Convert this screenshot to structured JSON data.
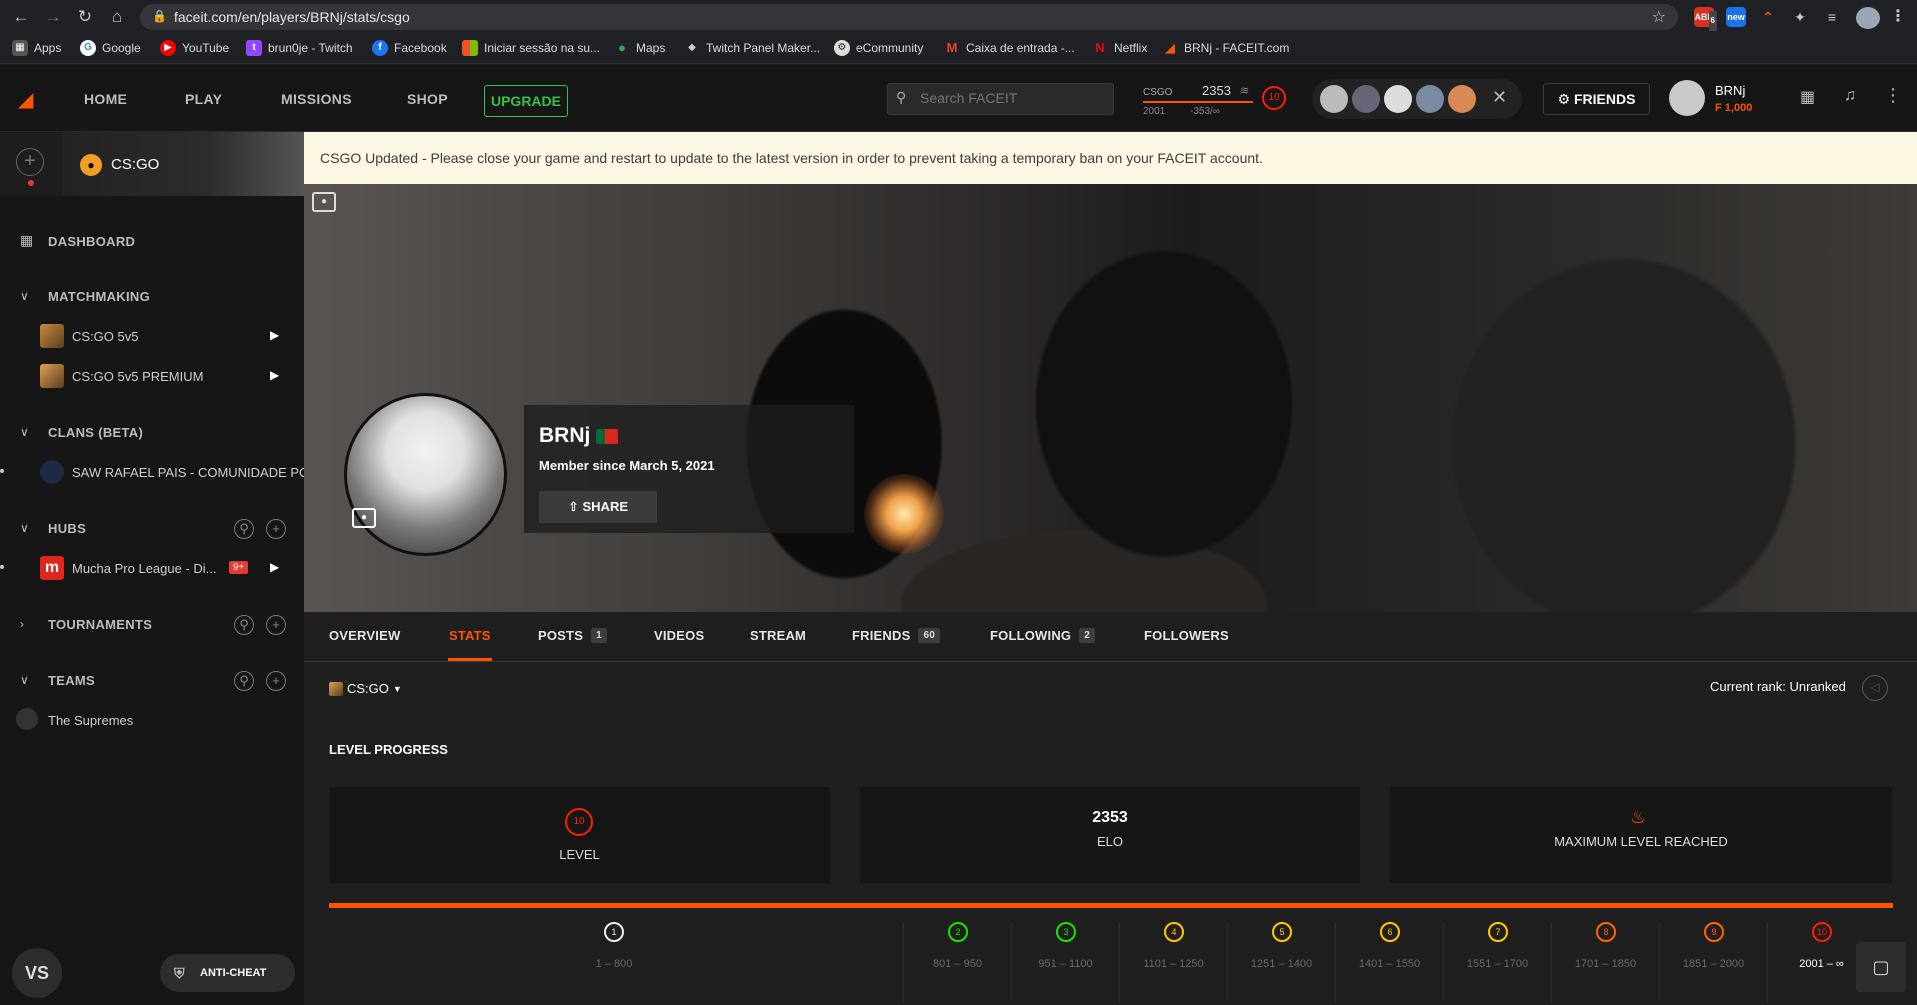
{
  "browser": {
    "url": "faceit.com/en/players/BRNj/stats/csgo",
    "bookmarks": [
      "Apps",
      "Google",
      "YouTube",
      "brun0je - Twitch",
      "Facebook",
      "Iniciar sessão na su...",
      "Maps",
      "Twitch Panel Maker...",
      "eCommunity",
      "Caixa de entrada -...",
      "Netflix",
      "BRNj - FACEIT.com"
    ],
    "ext_badges": [
      "6",
      "new"
    ]
  },
  "topbar": {
    "nav": [
      "HOME",
      "PLAY",
      "MISSIONS",
      "SHOP"
    ],
    "upgrade": "UPGRADE",
    "search_placeholder": "Search FACEIT",
    "game": "CSGO",
    "elo": "2353",
    "elo_min": "2001",
    "elo_diff": "-353/∞",
    "level": "10",
    "friends": "FRIENDS",
    "username": "BRNj",
    "points": "1,000"
  },
  "sidebar": {
    "game": "CS:GO",
    "dashboard": "DASHBOARD",
    "matchmaking": "MATCHMAKING",
    "mm_items": [
      "CS:GO 5v5",
      "CS:GO 5v5 PREMIUM"
    ],
    "clans": "CLANS (BETA)",
    "clan_item": "SAW RAFAEL PAIS - COMUNIDADE PORTUGUESA",
    "hubs": "HUBS",
    "hub_item": "Mucha Pro League - Di...",
    "hub_badge": "9+",
    "tournaments": "TOURNAMENTS",
    "teams": "TEAMS",
    "team_item": "The Supremes",
    "vs": "VS",
    "anticheat": "ANTI-CHEAT"
  },
  "notice": "CSGO Updated - Please close your game and restart to update to the latest version in order to prevent taking a temporary ban on your FACEIT account.",
  "profile": {
    "name": "BRNj",
    "member_since": "Member since March 5, 2021",
    "share": "SHARE"
  },
  "tabs": [
    {
      "label": "OVERVIEW",
      "count": ""
    },
    {
      "label": "STATS",
      "count": ""
    },
    {
      "label": "POSTS",
      "count": "1"
    },
    {
      "label": "VIDEOS",
      "count": ""
    },
    {
      "label": "STREAM",
      "count": ""
    },
    {
      "label": "FRIENDS",
      "count": "60"
    },
    {
      "label": "FOLLOWING",
      "count": "2"
    },
    {
      "label": "FOLLOWERS",
      "count": ""
    }
  ],
  "stats": {
    "game_select": "CS:GO",
    "current_rank": "Current rank: Unranked",
    "section_title": "LEVEL PROGRESS",
    "level_value": "10",
    "level_label": "LEVEL",
    "elo_value": "2353",
    "elo_label": "ELO",
    "max_label": "MAXIMUM LEVEL REACHED"
  },
  "levels": [
    {
      "n": "1",
      "range": "1 – 800",
      "color": "#eeeeee"
    },
    {
      "n": "2",
      "range": "801 – 950",
      "color": "#1ce400"
    },
    {
      "n": "3",
      "range": "951 – 1100",
      "color": "#1ce400"
    },
    {
      "n": "4",
      "range": "1101 – 1250",
      "color": "#ffc800"
    },
    {
      "n": "5",
      "range": "1251 – 1400",
      "color": "#ffc800"
    },
    {
      "n": "6",
      "range": "1401 – 1550",
      "color": "#ffc800"
    },
    {
      "n": "7",
      "range": "1551 – 1700",
      "color": "#ffc800"
    },
    {
      "n": "8",
      "range": "1701 – 1850",
      "color": "#ff6309"
    },
    {
      "n": "9",
      "range": "1851 – 2000",
      "color": "#ff6309"
    },
    {
      "n": "10",
      "range": "2001 – ∞",
      "color": "#fe1f00"
    }
  ],
  "colors": {
    "accent": "#ff5500",
    "upgrade": "#37c247",
    "notice_bg": "#fcf8e3"
  }
}
